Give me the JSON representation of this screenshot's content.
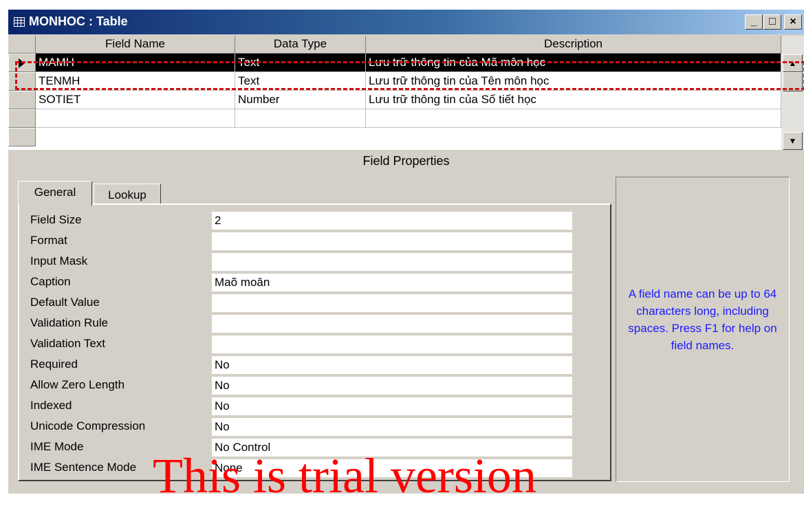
{
  "window": {
    "title": "MONHOC : Table",
    "controls": {
      "minimize": "_",
      "maximize": "□",
      "close": "×"
    }
  },
  "grid": {
    "columns": [
      "Field Name",
      "Data Type",
      "Description"
    ],
    "rows": [
      {
        "field": "MAMH",
        "type": "Text",
        "description": "Lưu trữ thông tin của Mã môn học"
      },
      {
        "field": "TENMH",
        "type": "Text",
        "description": "Lưu trữ thông tin của Tên môn học"
      },
      {
        "field": "SOTIET",
        "type": "Number",
        "description": "Lưu trữ thông tin của Số tiết học"
      },
      {
        "field": "",
        "type": "",
        "description": ""
      }
    ],
    "selected_row": 0
  },
  "field_properties": {
    "title": "Field Properties",
    "tabs": [
      "General",
      "Lookup"
    ],
    "active_tab": "General",
    "properties": [
      {
        "label": "Field Size",
        "value": "2"
      },
      {
        "label": "Format",
        "value": ""
      },
      {
        "label": "Input Mask",
        "value": ""
      },
      {
        "label": "Caption",
        "value": "Maõ moân"
      },
      {
        "label": "Default Value",
        "value": ""
      },
      {
        "label": "Validation Rule",
        "value": ""
      },
      {
        "label": "Validation Text",
        "value": ""
      },
      {
        "label": "Required",
        "value": "No"
      },
      {
        "label": "Allow Zero Length",
        "value": "No"
      },
      {
        "label": "Indexed",
        "value": "No"
      },
      {
        "label": "Unicode Compression",
        "value": "No"
      },
      {
        "label": "IME Mode",
        "value": "No Control"
      },
      {
        "label": "IME Sentence Mode",
        "value": "None"
      }
    ],
    "help_text": "A field name can be up to 64 characters long, including spaces. Press F1 for help on field names."
  },
  "watermark": "This is trial version",
  "colors": {
    "title_start": "#0a246a",
    "title_end": "#a6caf0",
    "face": "#d4d0c8",
    "help_text": "#1a1aff",
    "marker": "#cc1111",
    "watermark": "#ff0000"
  }
}
